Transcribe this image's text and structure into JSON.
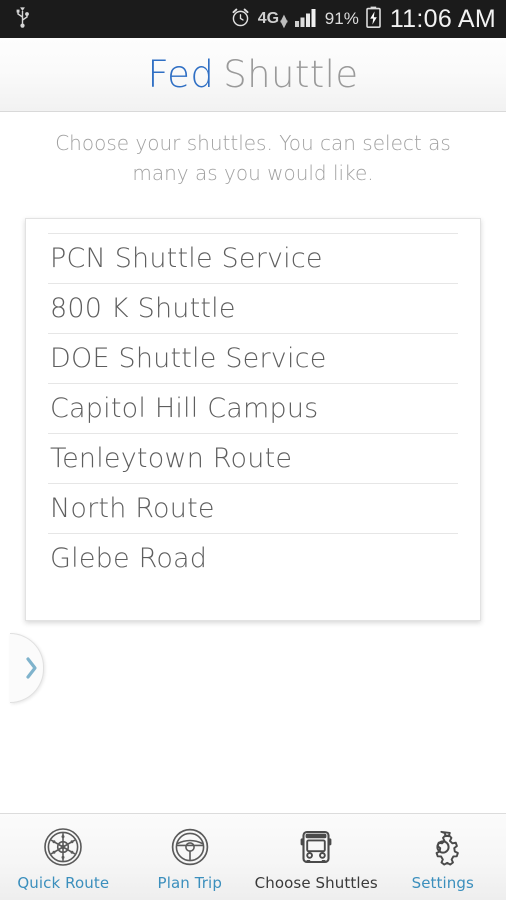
{
  "statusbar": {
    "usb_icon": "usb-icon",
    "alarm_icon": "alarm-clock-icon",
    "network_label": "4G",
    "network_icon": "lte-data-arrows-icon",
    "signal_icon": "signal-bars-icon",
    "battery_percent": "91%",
    "battery_icon": "battery-charging-icon",
    "time": "11:06 AM"
  },
  "header": {
    "title_primary": "Fed",
    "title_secondary": "Shuttle",
    "primary_color": "#2f6fc4",
    "secondary_color": "#9a9a9a"
  },
  "instructions": {
    "text": "Choose your shuttles. You can select as many as you would like."
  },
  "drawer": {
    "handle_icon": "chevron-right-icon",
    "handle_color": "#7fb3cc"
  },
  "shuttle_list": {
    "items": [
      {
        "label": "PCN Shuttle Service"
      },
      {
        "label": "800 K Shuttle"
      },
      {
        "label": "DOE Shuttle Service"
      },
      {
        "label": "Capitol Hill Campus"
      },
      {
        "label": "Tenleytown Route"
      },
      {
        "label": "North Route"
      },
      {
        "label": "Glebe Road"
      }
    ]
  },
  "tabbar": {
    "accent_color": "#3b8fbd",
    "active_color": "#3a3a3a",
    "items": [
      {
        "label": "Quick Route",
        "icon": "wheel-icon",
        "active": false
      },
      {
        "label": "Plan Trip",
        "icon": "steering-wheel-icon",
        "active": false
      },
      {
        "label": "Choose Shuttles",
        "icon": "bus-icon",
        "active": true
      },
      {
        "label": "Settings",
        "icon": "gear-icon",
        "active": false
      }
    ]
  }
}
